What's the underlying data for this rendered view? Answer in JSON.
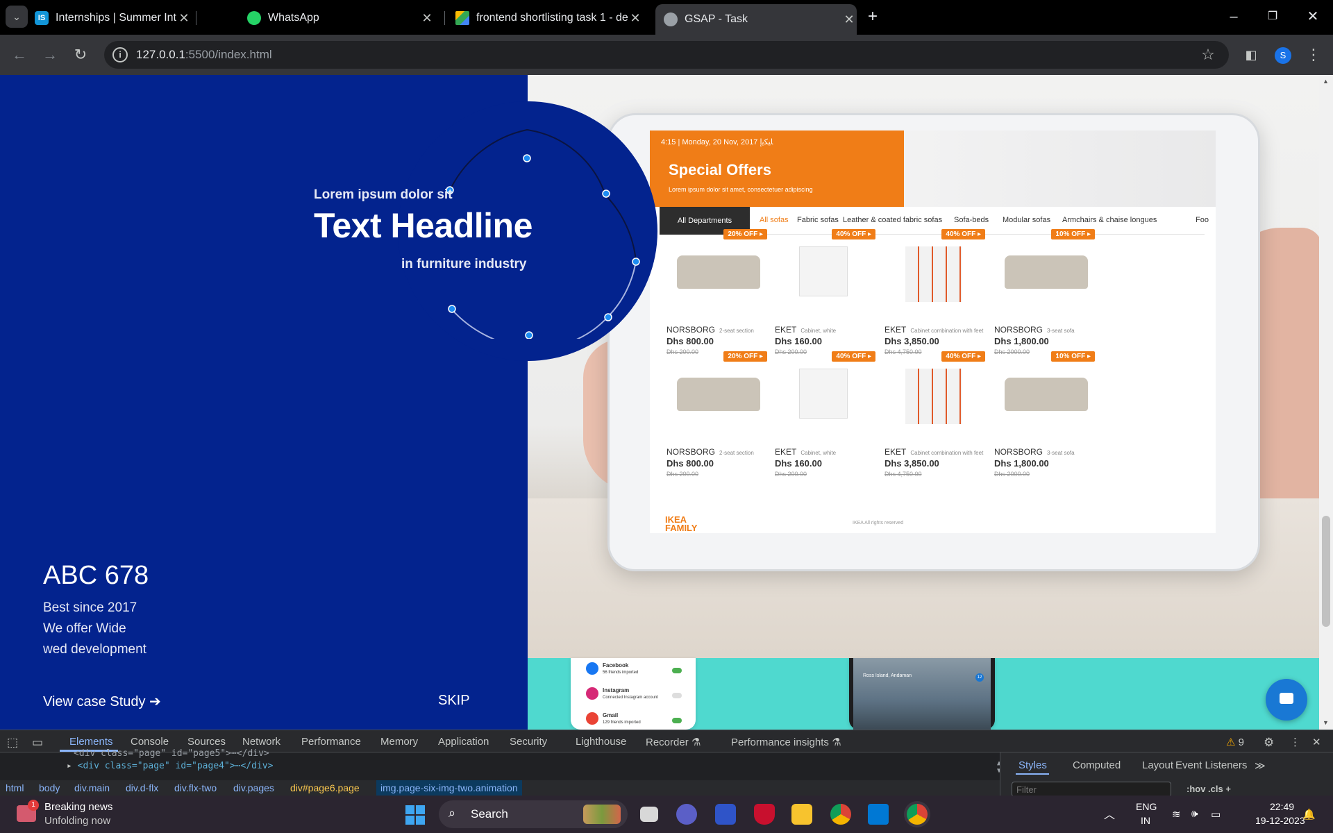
{
  "browser": {
    "tabs": [
      {
        "title": "Internships | Summer Internship",
        "favicon": "IS"
      },
      {
        "title": "WhatsApp",
        "favicon": "whatsapp-icon"
      },
      {
        "title": "frontend shortlisting task 1 - de",
        "favicon": "google-drive-icon"
      },
      {
        "title": "GSAP - Task",
        "favicon": "globe-icon",
        "active": true
      }
    ],
    "url_host": "127.0.0.1",
    "url_rest": ":5500/index.html",
    "profile_initial": "S"
  },
  "hero": {
    "small": "Lorem ipsum dolor sit",
    "title": "Text Headline",
    "sub": "in furniture industry"
  },
  "brand": {
    "name": "ABC 678",
    "lines": [
      "Best since 2017",
      "We offer Wide",
      "wed development"
    ],
    "cta": "View case Study ➔",
    "skip": "SKIP"
  },
  "tablet": {
    "time": "4:15 | Monday, 20 Nov, 2017  ﺎﻴﻜﻳإ",
    "title": "Special Offers",
    "subtitle": "Lorem ipsum dolor sit amet, consectetuer adipiscing",
    "categories": [
      "All Departments",
      "All sofas",
      "Fabric sofas",
      "Leather & coated fabric sofas",
      "Sofa-beds",
      "Modular sofas",
      "Armchairs & chaise longues",
      "Foo"
    ],
    "products": [
      {
        "name": "NORSBORG",
        "desc": "2-seat section",
        "price": "Dhs 800.00",
        "old": "Dhs 200.00",
        "badge": "20% OFF ▸",
        "kind": "sofa"
      },
      {
        "name": "EKET",
        "desc": "Cabinet, white",
        "price": "Dhs 160.00",
        "old": "Dhs 200.00",
        "badge": "40% OFF ▸",
        "kind": "cube"
      },
      {
        "name": "EKET",
        "desc": "Cabinet combination with feet",
        "price": "Dhs 3,850.00",
        "old": "Dhs 4,750.00",
        "badge": "40% OFF ▸",
        "kind": "shelf"
      },
      {
        "name": "NORSBORG",
        "desc": "3-seat sofa",
        "price": "Dhs 1,800.00",
        "old": "Dhs 2000.00",
        "badge": "10% OFF ▸",
        "kind": "sofa"
      },
      {
        "name": "NORSBORG",
        "desc": "2-seat section",
        "price": "Dhs 800.00",
        "old": "Dhs 200.00",
        "badge": "20% OFF ▸",
        "kind": "sofa"
      },
      {
        "name": "EKET",
        "desc": "Cabinet, white",
        "price": "Dhs 160.00",
        "old": "Dhs 200.00",
        "badge": "40% OFF ▸",
        "kind": "cube"
      },
      {
        "name": "EKET",
        "desc": "Cabinet combination with feet",
        "price": "Dhs 3,850.00",
        "old": "Dhs 4,750.00",
        "badge": "40% OFF ▸",
        "kind": "shelf"
      },
      {
        "name": "NORSBORG",
        "desc": "3-seat sofa",
        "price": "Dhs 1,800.00",
        "old": "Dhs 2000.00",
        "badge": "10% OFF ▸",
        "kind": "sofa"
      }
    ],
    "ikea_line1": "IKEA",
    "ikea_line2": "FAMILY",
    "rights": "IKEA All rights reserved"
  },
  "phones": {
    "settings": [
      {
        "name": "Facebook",
        "detail": "56 friends imported",
        "color": "#1877f2"
      },
      {
        "name": "Instagram",
        "detail": "Connected Instagram account",
        "color": "#d62976"
      },
      {
        "name": "Gmail",
        "detail": "129 friends imported",
        "color": "#ea4335"
      }
    ],
    "location": "Ross Island, Andaman",
    "location_badge": "12"
  },
  "devtools": {
    "tabs": [
      "Elements",
      "Console",
      "Sources",
      "Network",
      "Performance",
      "Memory",
      "Application",
      "Security",
      "Lighthouse",
      "Recorder ⚗",
      "Performance insights ⚗"
    ],
    "warnings": "9",
    "code_line_top": "<div class=\"page\" id=\"page5\">⋯</div>",
    "code_line": "<div class=\"page\" id=\"page4\">⋯</div>",
    "breadcrumbs": [
      "html",
      "body",
      "div.main",
      "div.d-flx",
      "div.flx-two",
      "div.pages",
      "div#page6.page",
      "img.page-six-img-two.animation"
    ],
    "side_tabs": [
      "Styles",
      "Computed",
      "Layout",
      "Event Listeners",
      "≫"
    ],
    "filter_placeholder": "Filter",
    "filter_tools": ":hov  .cls  +"
  },
  "taskbar": {
    "news_title": "Breaking news",
    "news_sub": "Unfolding now",
    "news_badge": "1",
    "search": "Search",
    "lang1": "ENG",
    "lang2": "IN",
    "time": "22:49",
    "date": "19-12-2023"
  },
  "colors": {
    "hero_blue": "#03238e",
    "accent_orange": "#f07d17",
    "teal": "#4fd9cf"
  }
}
